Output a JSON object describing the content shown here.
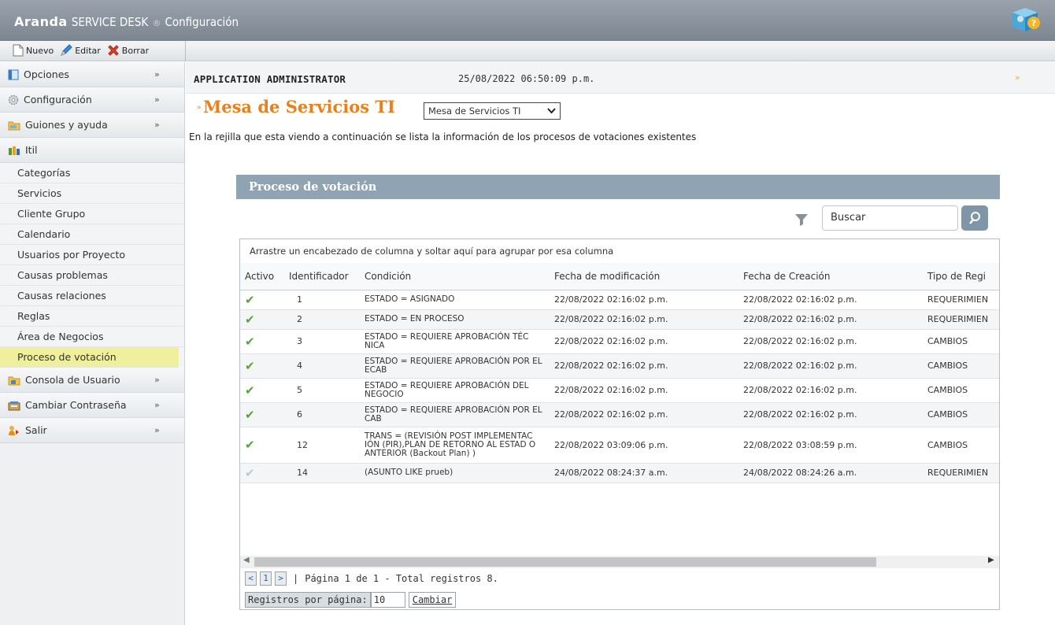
{
  "header": {
    "brand": "Aranda",
    "product": "SERVICE DESK",
    "reg": "®",
    "section": "Configuración"
  },
  "toolbar": {
    "new_label": "Nuevo",
    "edit_label": "Editar",
    "delete_label": "Borrar"
  },
  "sidebar": {
    "sections": [
      {
        "label": "Opciones",
        "icon": "window-icon"
      },
      {
        "label": "Configuración",
        "icon": "gear-icon"
      },
      {
        "label": "Guiones y ayuda",
        "icon": "folder-icon"
      },
      {
        "label": "Itil",
        "icon": "people-icon"
      }
    ],
    "itil_items": [
      "Categorías",
      "Servicios",
      "Cliente Grupo",
      "Calendario",
      "Usuarios por Proyecto",
      "Causas problemas",
      "Causas relaciones",
      "Reglas",
      "Área de Negocios",
      "Proceso de votación"
    ],
    "bottom_sections": [
      {
        "label": "Consola de Usuario",
        "icon": "folder-icon"
      },
      {
        "label": "Cambiar Contraseña",
        "icon": "key-icon"
      },
      {
        "label": "Salir",
        "icon": "exit-icon"
      }
    ],
    "active_item": "Proceso de votación"
  },
  "userbar": {
    "user": "APPLICATION ADMINISTRATOR",
    "datetime": "25/08/2022 06:50:09 p.m."
  },
  "page": {
    "title": "Mesa de Servicios TI",
    "project_select": "Mesa de Servicios TI",
    "description": "En la rejilla que esta viendo a continuación se lista la información de los procesos de votaciones existentes"
  },
  "panel": {
    "title": "Proceso de votación",
    "search_placeholder": "Buscar",
    "group_hint": "Arrastre un encabezado de columna y soltar aquí para agrupar por esa columna"
  },
  "grid": {
    "columns": [
      "Activo",
      "Identificador",
      "Condición",
      "Fecha de modificación",
      "Fecha de Creación",
      "Tipo de Regi"
    ],
    "rows": [
      {
        "active": true,
        "id": "1",
        "condition": "ESTADO = ASIGNADO",
        "modified": "22/08/2022 02:16:02 p.m.",
        "created": "22/08/2022 02:16:02 p.m.",
        "type": "REQUERIMIEN"
      },
      {
        "active": true,
        "id": "2",
        "condition": "ESTADO = EN PROCESO",
        "modified": "22/08/2022 02:16:02 p.m.",
        "created": "22/08/2022 02:16:02 p.m.",
        "type": "REQUERIMIEN"
      },
      {
        "active": true,
        "id": "3",
        "condition": "ESTADO = REQUIERE APROBACIÓN TÉC NICA",
        "modified": "22/08/2022 02:16:02 p.m.",
        "created": "22/08/2022 02:16:02 p.m.",
        "type": "CAMBIOS"
      },
      {
        "active": true,
        "id": "4",
        "condition": "ESTADO = REQUIERE APROBACIÓN POR EL ECAB",
        "modified": "22/08/2022 02:16:02 p.m.",
        "created": "22/08/2022 02:16:02 p.m.",
        "type": "CAMBIOS"
      },
      {
        "active": true,
        "id": "5",
        "condition": "ESTADO = REQUIERE APROBACIÓN DEL NEGOCIO",
        "modified": "22/08/2022 02:16:02 p.m.",
        "created": "22/08/2022 02:16:02 p.m.",
        "type": "CAMBIOS"
      },
      {
        "active": true,
        "id": "6",
        "condition": "ESTADO = REQUIERE APROBACIÓN POR EL CAB",
        "modified": "22/08/2022 02:16:02 p.m.",
        "created": "22/08/2022 02:16:02 p.m.",
        "type": "CAMBIOS"
      },
      {
        "active": true,
        "id": "12",
        "condition": "TRANS = (REVISIÓN POST IMPLEMENTAC IÓN (PIR),PLAN DE RETORNO AL ESTAD O ANTERIOR (Backout Plan) )",
        "modified": "22/08/2022 03:09:06 p.m.",
        "created": "22/08/2022 03:08:59 p.m.",
        "type": "CAMBIOS"
      },
      {
        "active": false,
        "id": "14",
        "condition": "(ASUNTO LIKE prueb)",
        "modified": "24/08/2022 08:24:37 a.m.",
        "created": "24/08/2022 08:24:26 a.m.",
        "type": "REQUERIMIEN"
      }
    ]
  },
  "pager": {
    "prev": "<",
    "page": "1",
    "next": ">",
    "sep": "|",
    "summary": "Página 1 de 1 - Total registros 8.",
    "per_page_label": "Registros por página:",
    "per_page_value": "10",
    "change_label": "Cambiar"
  },
  "colors": {
    "accent": "#e8811a",
    "panel_header": "#90a3b3",
    "active_item": "#f0ef9e",
    "check_on": "#58a23a"
  }
}
